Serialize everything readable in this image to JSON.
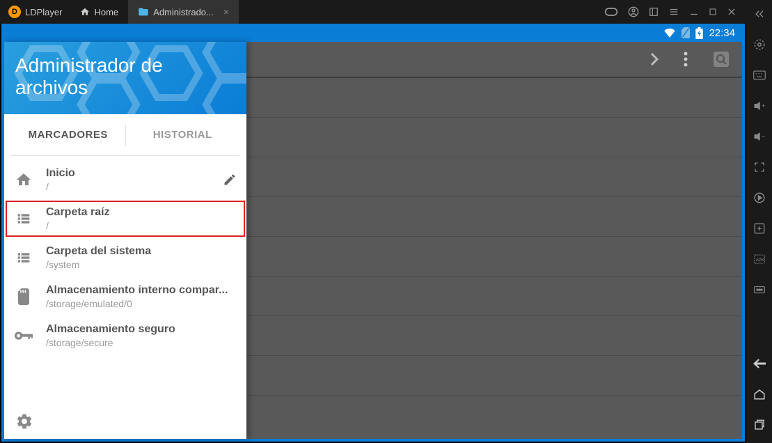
{
  "titlebar": {
    "brand": "LDPlayer",
    "home_tab": "Home",
    "active_tab": "Administrado..."
  },
  "status": {
    "time": "22:34"
  },
  "drawer": {
    "title": "Administrador de archivos",
    "tabs": {
      "bookmarks": "MARCADORES",
      "history": "HISTORIAL"
    },
    "items": [
      {
        "title": "Inicio",
        "path": "/"
      },
      {
        "title": "Carpeta raíz",
        "path": "/"
      },
      {
        "title": "Carpeta del sistema",
        "path": "/system"
      },
      {
        "title": "Almacenamiento interno compar...",
        "path": "/storage/emulated/0"
      },
      {
        "title": "Almacenamiento seguro",
        "path": "/storage/secure"
      }
    ]
  },
  "colors": {
    "blue": "#0a7dd6",
    "highlight": "#d22"
  }
}
